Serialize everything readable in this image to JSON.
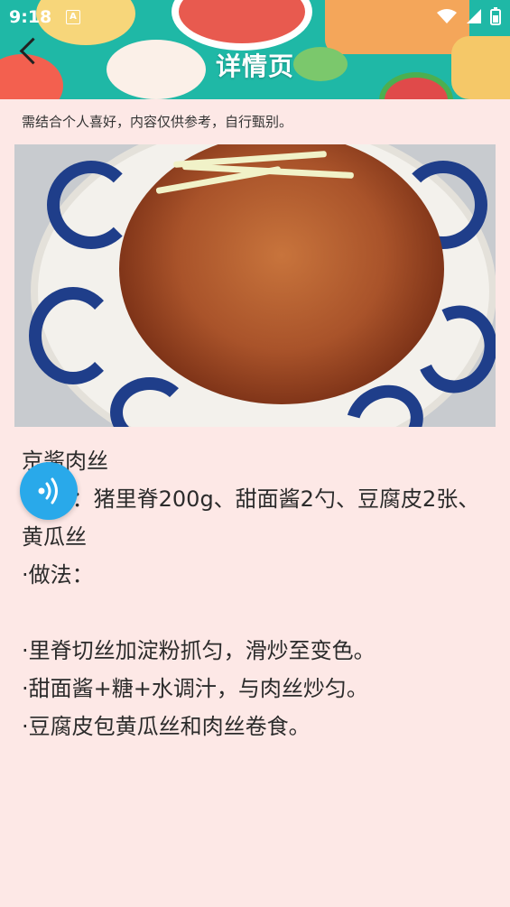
{
  "status_bar": {
    "time": "9:18",
    "notification_letter": "A"
  },
  "header": {
    "title": "详情页"
  },
  "disclaimer": "需结合个人喜好，内容仅供参考，自行甄别。",
  "recipe": {
    "name": "京酱肉丝",
    "ingredients_label": "·用料：",
    "ingredients": "猪里脊200g、甜面酱2勺、豆腐皮2张、黄瓜丝",
    "method_label": "·做法：",
    "steps": [
      "·里脊切丝加淀粉抓匀，滑炒至变色。",
      "·甜面酱+糖+水调汁，与肉丝炒匀。",
      "·豆腐皮包黄瓜丝和肉丝卷食。"
    ]
  },
  "icons": [
    "back-arrow-icon",
    "wifi-icon",
    "battery-icon",
    "audio-wave-icon"
  ],
  "colors": {
    "header": "#1FB8A6",
    "background": "#FDE8E6",
    "float_button": "#29A9EA"
  }
}
